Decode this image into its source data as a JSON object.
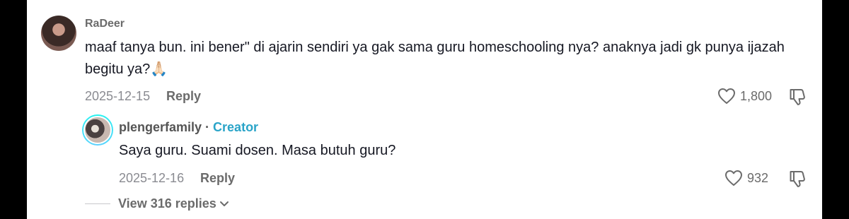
{
  "comment": {
    "username": "RaDeer",
    "text": "maaf tanya bun. ini bener\" di ajarin sendiri ya gak sama guru homeschooling nya? anaknya jadi gk punya ijazah begitu ya?",
    "emoji": "🙏🏻",
    "date": "2025-12-15",
    "reply_label": "Reply",
    "likes": "1,800"
  },
  "reply": {
    "username": "plengerfamily",
    "separator": " · ",
    "creator_label": "Creator",
    "text": "Saya guru. Suami dosen. Masa butuh guru?",
    "date": "2025-12-16",
    "reply_label": "Reply",
    "likes": "932"
  },
  "view_replies": {
    "label": "View 316 replies"
  },
  "icons": {
    "like": "heart-outline-icon",
    "dislike": "thumbs-down-outline-icon",
    "chevron": "chevron-down-icon"
  }
}
